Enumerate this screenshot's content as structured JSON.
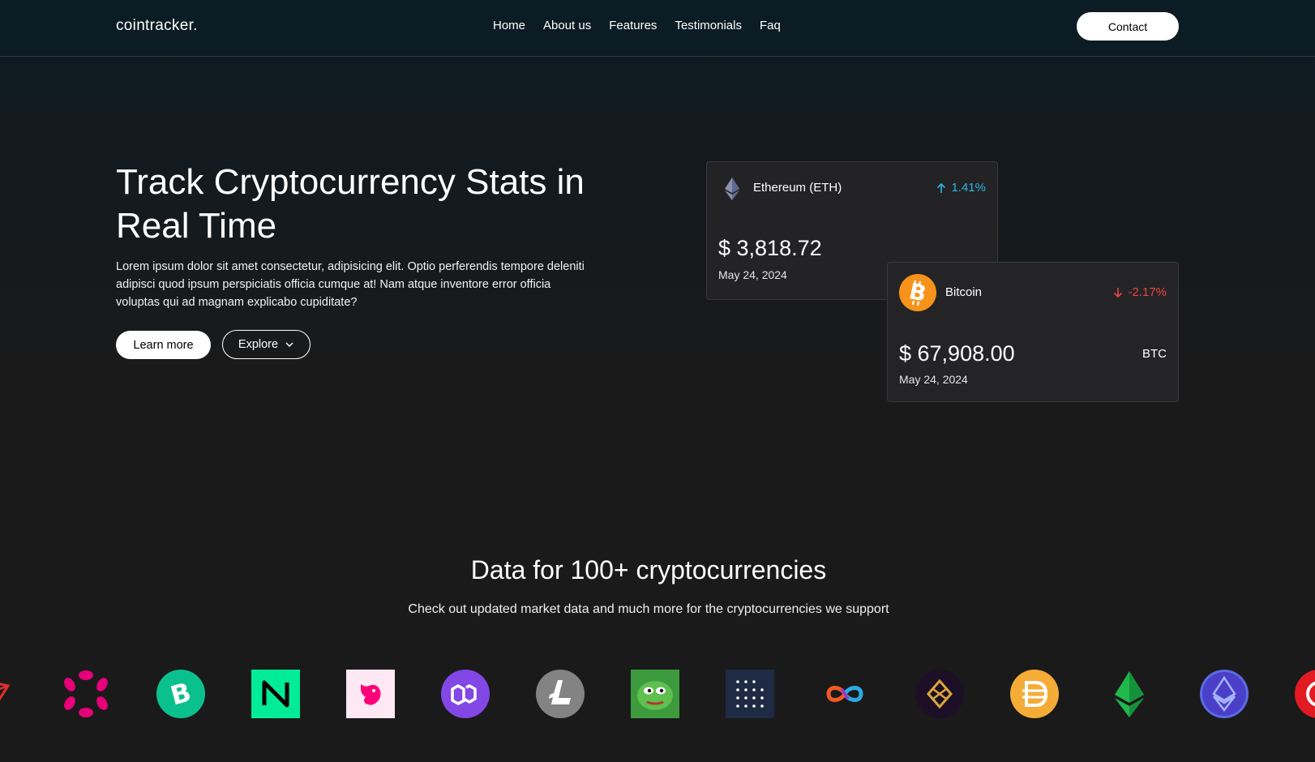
{
  "nav": {
    "brand": "cointracker.",
    "links": [
      "Home",
      "About us",
      "Features",
      "Testimonials",
      "Faq"
    ],
    "contact_label": "Contact"
  },
  "hero": {
    "title": "Track Cryptocurrency Stats in Real Time",
    "description": "Lorem ipsum dolor sit amet consectetur, adipisicing elit. Optio perferendis tempore deleniti adipisci quod ipsum perspiciatis officia cumque at! Nam atque inventore error officia voluptas qui ad magnam explicabo cupiditate?",
    "learn_more_label": "Learn more",
    "explore_label": "Explore"
  },
  "cards": {
    "eth": {
      "name": "Ethereum (ETH)",
      "change": "1.41%",
      "direction": "up",
      "price": "$ 3,818.72",
      "date": "May 24, 2024"
    },
    "btc": {
      "name": "Bitcoin",
      "change": "-2.17%",
      "direction": "down",
      "price": "$ 67,908.00",
      "date": "May 24, 2024",
      "symbol": "BTC"
    }
  },
  "section": {
    "title": "Data for 100+ cryptocurrencies",
    "subtitle": "Check out updated market data and much more for the cryptocurrencies we support"
  },
  "logos": [
    "tron-icon",
    "polkadot-icon",
    "bitcoin-cash-icon",
    "near-icon",
    "uniswap-icon",
    "polygon-icon",
    "litecoin-icon",
    "pepe-icon",
    "dots-grid-icon",
    "internet-computer-icon",
    "bonk-icon",
    "dai-icon",
    "ethereum-green-icon",
    "ethereum-name-service-icon",
    "red-coin-icon"
  ],
  "colors": {
    "accent_up": "#2ab6e8",
    "accent_down": "#ef4444",
    "bitcoin_orange": "#f7931a"
  }
}
